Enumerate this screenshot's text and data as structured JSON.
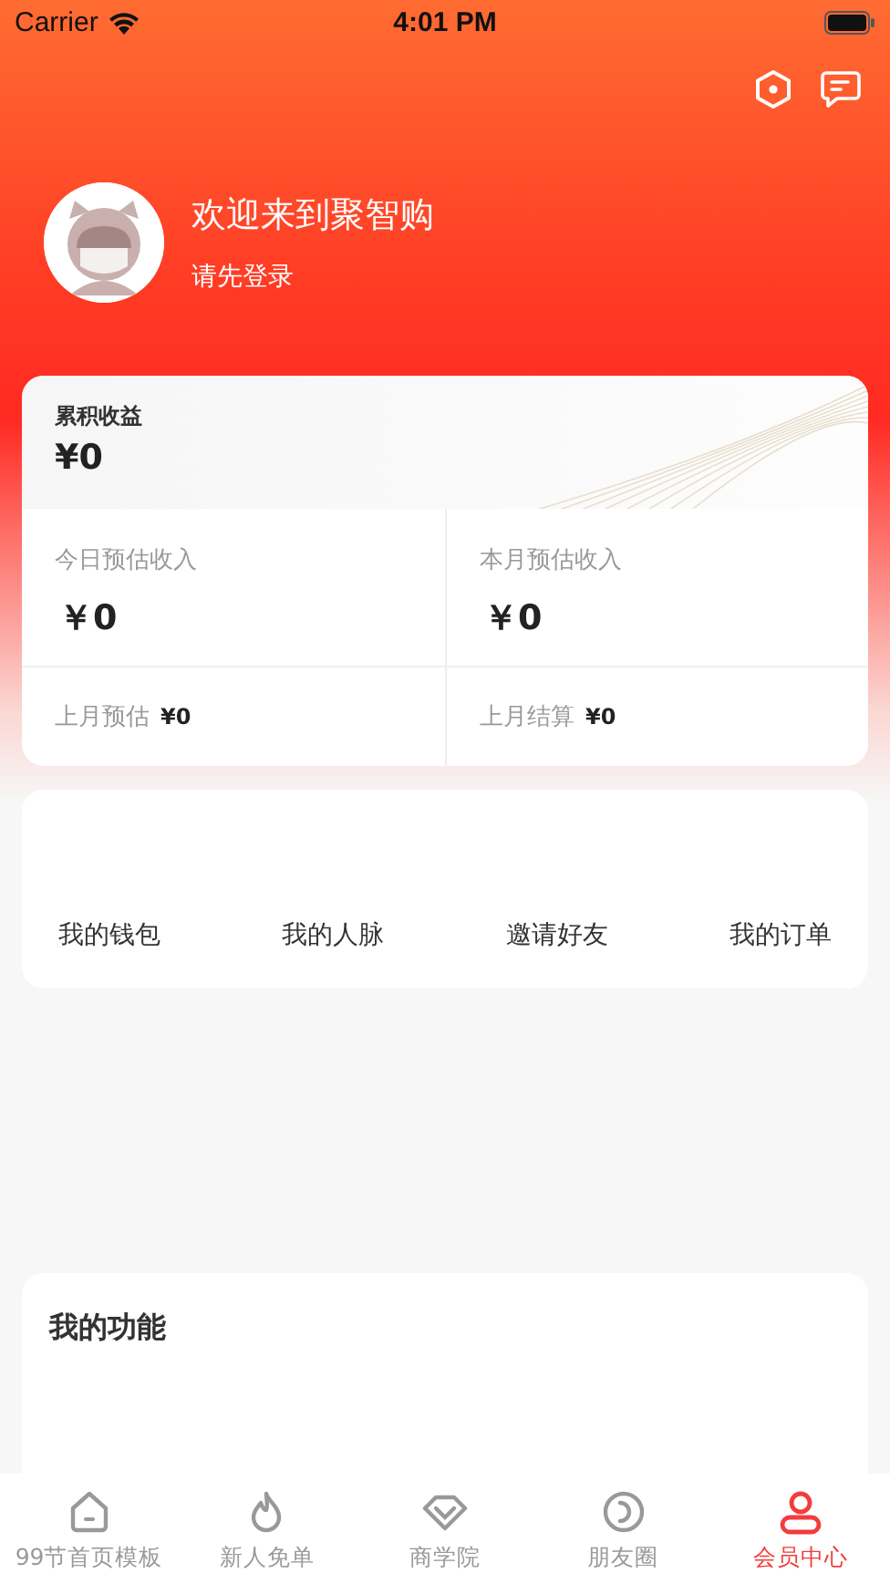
{
  "status_bar": {
    "carrier": "Carrier",
    "time": "4:01 PM"
  },
  "header": {
    "title": "欢迎来到聚智购",
    "subtitle": "请先登录"
  },
  "earnings": {
    "total": {
      "label": "累积收益",
      "value": "¥0"
    },
    "estimates": [
      {
        "label": "今日预估收入",
        "value": "￥0"
      },
      {
        "label": "本月预估收入",
        "value": "￥0"
      }
    ],
    "last_month": [
      {
        "label": "上月预估",
        "value": "¥0"
      },
      {
        "label": "上月结算",
        "value": "¥0"
      }
    ]
  },
  "shortcuts": [
    "我的钱包",
    "我的人脉",
    "邀请好友",
    "我的订单"
  ],
  "functions": {
    "title": "我的功能"
  },
  "tabs": [
    {
      "label": "99节首页模板",
      "kind": "home",
      "selected": false
    },
    {
      "label": "新人免单",
      "kind": "flame",
      "selected": false
    },
    {
      "label": "商学院",
      "kind": "diamond",
      "selected": false
    },
    {
      "label": "朋友圈",
      "kind": "circle",
      "selected": false
    },
    {
      "label": "会员中心",
      "kind": "person",
      "selected": true
    }
  ]
}
